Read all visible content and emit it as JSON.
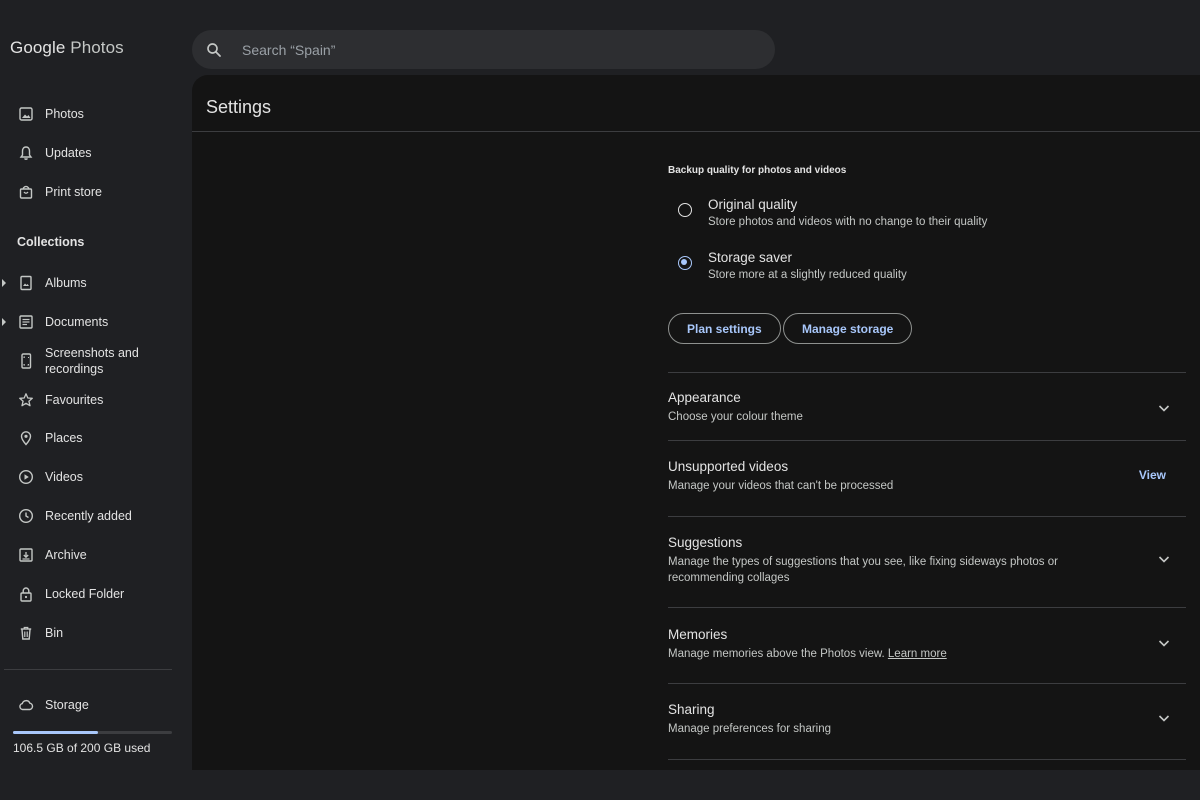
{
  "app": {
    "logo_google": "Google",
    "logo_photos": "Photos"
  },
  "search": {
    "placeholder": "Search “Spain”"
  },
  "sidebar": {
    "items": [
      {
        "label": "Photos",
        "icon": "photo-icon"
      },
      {
        "label": "Updates",
        "icon": "bell-icon"
      },
      {
        "label": "Print store",
        "icon": "shopping-bag-icon"
      }
    ],
    "collections_title": "Collections",
    "collections": [
      {
        "label": "Albums",
        "icon": "album-icon",
        "expandable": true
      },
      {
        "label": "Documents",
        "icon": "document-icon",
        "expandable": true
      },
      {
        "label": "Screenshots and recordings",
        "icon": "phone-screenshot-icon"
      },
      {
        "label": "Favourites",
        "icon": "star-icon"
      },
      {
        "label": "Places",
        "icon": "place-pin-icon"
      },
      {
        "label": "Videos",
        "icon": "play-circle-icon"
      },
      {
        "label": "Recently added",
        "icon": "clock-icon"
      },
      {
        "label": "Archive",
        "icon": "archive-icon"
      },
      {
        "label": "Locked Folder",
        "icon": "lock-icon"
      },
      {
        "label": "Bin",
        "icon": "trash-icon"
      }
    ],
    "storage": {
      "label": "Storage",
      "icon": "cloud-icon",
      "used_text": "106.5 GB of 200 GB used",
      "used_fraction": 0.5325
    }
  },
  "main": {
    "title": "Settings",
    "backup": {
      "label": "Backup quality for photos and videos",
      "options": [
        {
          "title": "Original quality",
          "desc": "Store photos and videos with no change to their quality",
          "selected": false
        },
        {
          "title": "Storage saver",
          "desc": "Store more at a slightly reduced quality",
          "selected": true
        }
      ],
      "buttons": {
        "plan": "Plan settings",
        "manage": "Manage storage"
      }
    },
    "settings": [
      {
        "title": "Appearance",
        "desc": "Choose your colour theme",
        "action": "expand"
      },
      {
        "title": "Unsupported videos",
        "desc": "Manage your videos that can't be processed",
        "action": "link",
        "action_label": "View"
      },
      {
        "title": "Suggestions",
        "desc": "Manage the types of suggestions that you see, like fixing sideways photos or recommending collages",
        "action": "expand"
      },
      {
        "title": "Memories",
        "desc": "Manage memories above the Photos view.",
        "link_text": "Learn more",
        "action": "expand"
      },
      {
        "title": "Sharing",
        "desc": "Manage preferences for sharing",
        "action": "expand"
      }
    ]
  },
  "colors": {
    "accent": "#a8c7fa",
    "background": "#1f2023",
    "panel": "#141414"
  }
}
